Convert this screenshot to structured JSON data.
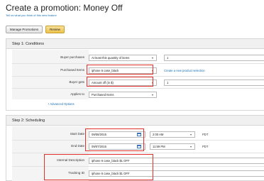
{
  "page": {
    "title": "Create a promotion: Money Off",
    "feedback_link": "Tell us what you think of this new feature"
  },
  "toolbar": {
    "manage_label": "Manage Promotions",
    "review_label": "Review"
  },
  "step1": {
    "header": "Step 1: Conditions",
    "buyer_purchases_label": "Buyer purchases",
    "buyer_purchases_value": "At least this quantity of items",
    "buyer_purchases_qty": "1",
    "purchased_items_label": "Purchased Items",
    "purchased_items_value": "iphone 6 case_black",
    "create_link": "Create a new product selection",
    "buyer_gets_label": "Buyer gets",
    "buyer_gets_value": "Amount off (in $)",
    "buyer_gets_amount": "1",
    "applies_to_label": "Applies to",
    "applies_to_value": "Purchased Items",
    "advanced_options": "+ Advanced Options"
  },
  "step2": {
    "header": "Step 2: Scheduling",
    "start_date_label": "Start Date",
    "start_date": "09/06/2015",
    "start_time": "2:00 AM",
    "start_tz": "PDT",
    "end_date_label": "End Date",
    "end_date": "09/07/2015",
    "end_time": "11:59 PM",
    "end_tz": "PDT",
    "internal_desc_label": "Internal Description",
    "internal_desc_value": "iphone 6 case_black $1 OFF",
    "tracking_id_label": "Tracking ID",
    "tracking_id_value": "iphone 6 case_black $1 OFF"
  },
  "colors": {
    "highlight": "#e0302a",
    "review_button": "#efc24c",
    "link": "#1a6fb3"
  }
}
